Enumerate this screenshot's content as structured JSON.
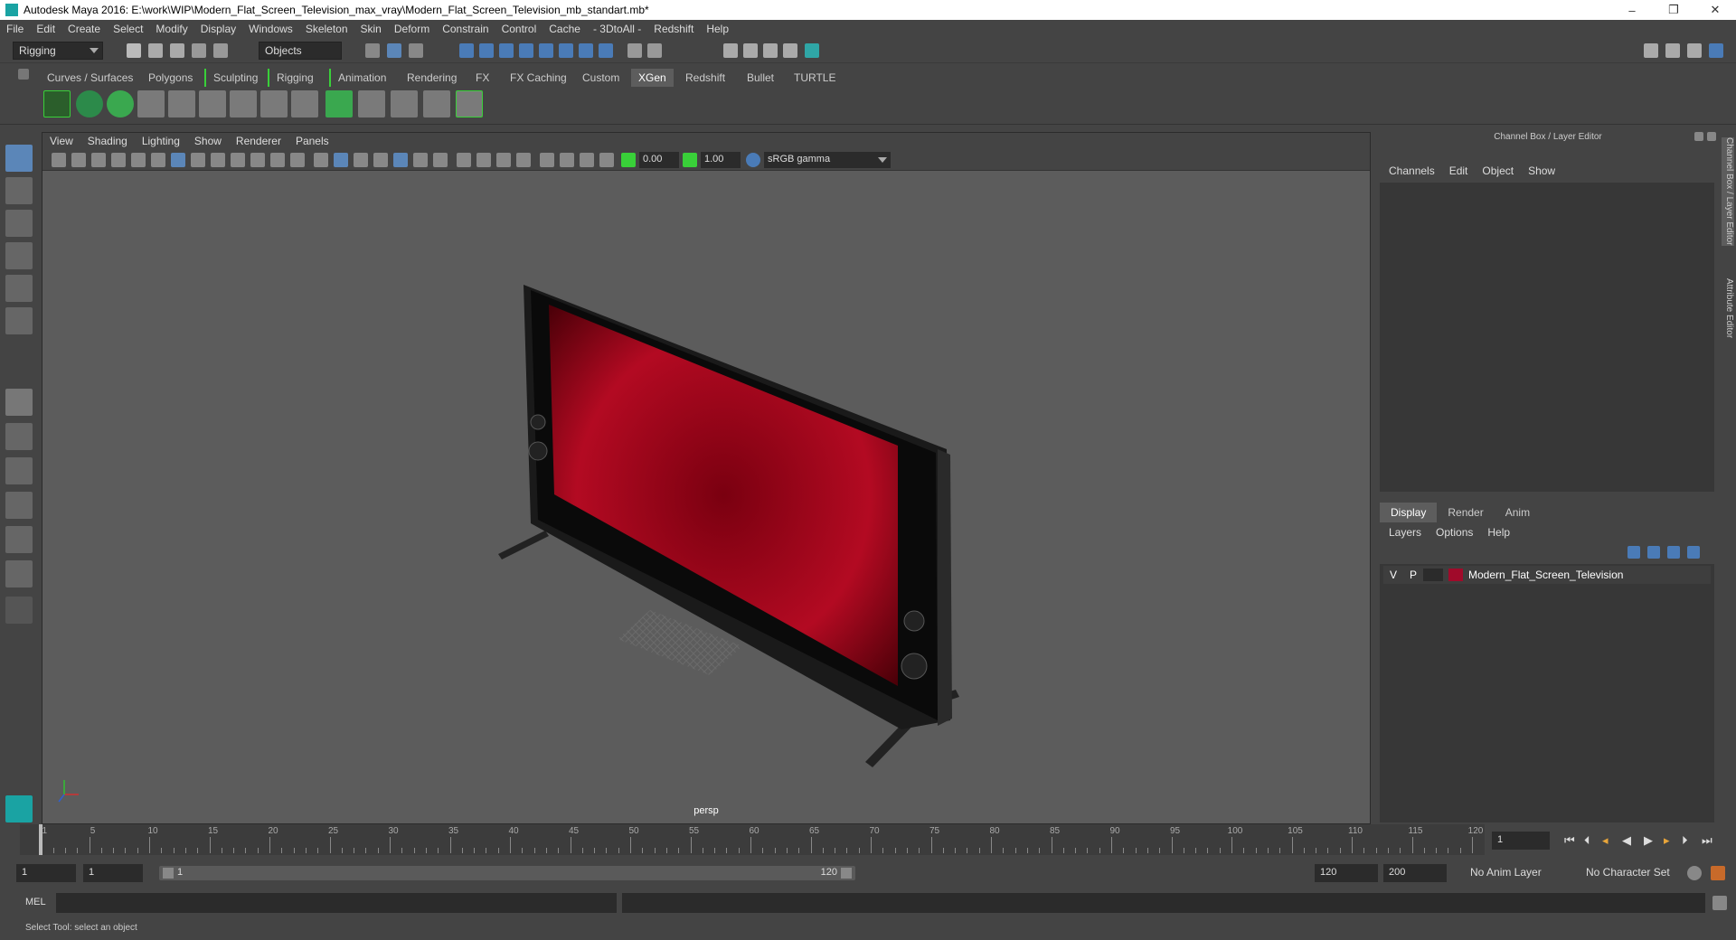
{
  "window": {
    "title": "Autodesk Maya 2016: E:\\work\\WIP\\Modern_Flat_Screen_Television_max_vray\\Modern_Flat_Screen_Television_mb_standart.mb*",
    "min": "–",
    "max": "❐",
    "close": "✕"
  },
  "menubar": [
    "File",
    "Edit",
    "Create",
    "Select",
    "Modify",
    "Display",
    "Windows",
    "Skeleton",
    "Skin",
    "Deform",
    "Constrain",
    "Control",
    "Cache",
    "- 3DtoAll -",
    "Redshift",
    "Help"
  ],
  "statusline": {
    "mode": "Rigging",
    "selection_mask": "Objects"
  },
  "shelf_tabs": [
    "Curves / Surfaces",
    "Polygons",
    "Sculpting",
    "Rigging",
    "Animation",
    "Rendering",
    "FX",
    "FX Caching",
    "Custom",
    "XGen",
    "Redshift",
    "Bullet",
    "TURTLE"
  ],
  "shelf_active": "XGen",
  "viewport": {
    "menu": [
      "View",
      "Shading",
      "Lighting",
      "Show",
      "Renderer",
      "Panels"
    ],
    "exposure": "0.00",
    "gamma": "1.00",
    "color_space": "sRGB gamma",
    "camera_label": "persp"
  },
  "channel_box": {
    "title": "Channel Box / Layer Editor",
    "menu": [
      "Channels",
      "Edit",
      "Object",
      "Show"
    ]
  },
  "layer_editor": {
    "tabs": [
      "Display",
      "Render",
      "Anim"
    ],
    "active_tab": "Display",
    "menu": [
      "Layers",
      "Options",
      "Help"
    ],
    "layers": [
      {
        "v": "V",
        "p": "P",
        "color": "#a00a2a",
        "name": "Modern_Flat_Screen_Television"
      }
    ]
  },
  "side_tabs": [
    "Channel Box / Layer Editor",
    "Attribute Editor"
  ],
  "timeline": {
    "tick_labels": [
      "1",
      "5",
      "10",
      "15",
      "20",
      "25",
      "30",
      "35",
      "40",
      "45",
      "50",
      "55",
      "60",
      "65",
      "70",
      "75",
      "80",
      "85",
      "90",
      "95",
      "100",
      "105",
      "110",
      "115",
      "120"
    ],
    "tick_values": [
      1,
      5,
      10,
      15,
      20,
      25,
      30,
      35,
      40,
      45,
      50,
      55,
      60,
      65,
      70,
      75,
      80,
      85,
      90,
      95,
      100,
      105,
      110,
      115,
      120
    ],
    "current_frame": "1"
  },
  "range": {
    "start": "1",
    "playback_start": "1",
    "slider_start": "1",
    "slider_end": "120",
    "playback_end": "120",
    "end": "200",
    "anim_layer": "No Anim Layer",
    "character_set": "No Character Set"
  },
  "cmdline": {
    "label": "MEL"
  },
  "help_line": "Select Tool: select an object"
}
